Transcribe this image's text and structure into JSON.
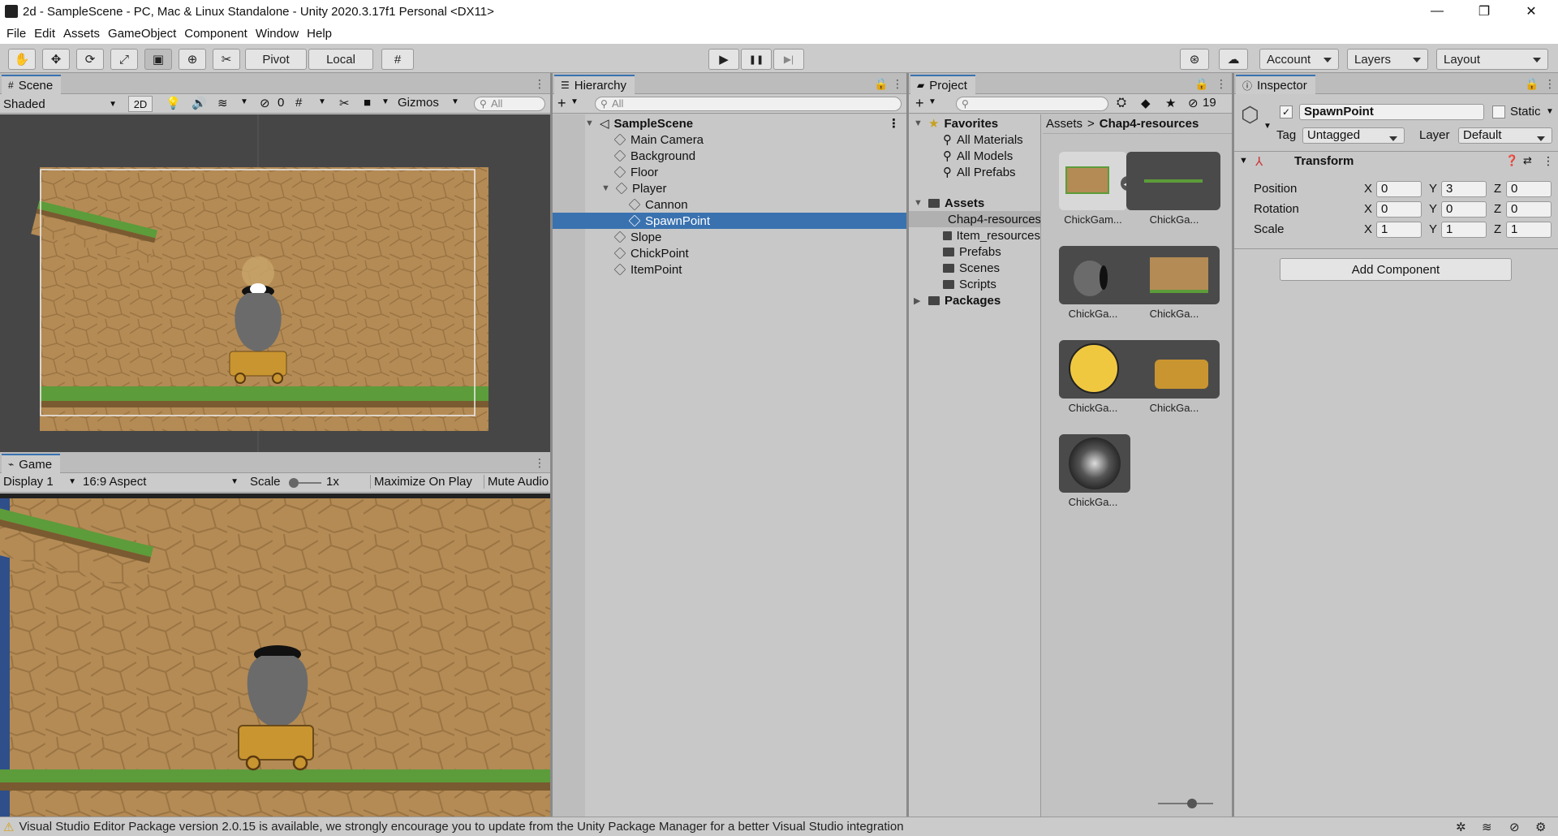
{
  "window": {
    "title": "2d - SampleScene - PC, Mac & Linux Standalone - Unity 2020.3.17f1 Personal <DX11>",
    "controls": {
      "minimize": "—",
      "maximize": "❐",
      "close": "✕"
    }
  },
  "menu": [
    "File",
    "Edit",
    "Assets",
    "GameObject",
    "Component",
    "Window",
    "Help"
  ],
  "toolbar": {
    "tools": [
      "hand-icon",
      "move-icon",
      "rotate-icon",
      "scale-icon",
      "rect-icon",
      "transform-icon",
      "custom-tool-icon"
    ],
    "pivot_label": "Pivot",
    "local_label": "Local",
    "play_icon": "▶",
    "pause_icon": "❚❚",
    "step_icon": "▶|",
    "account_label": "Account",
    "layers_label": "Layers",
    "layout_label": "Layout"
  },
  "scene": {
    "tab_label": "Scene",
    "shading_mode": "Shaded",
    "mode_2d": "2D",
    "hidden_count": "0",
    "gizmos_label": "Gizmos",
    "search_placeholder": "All"
  },
  "game": {
    "tab_label": "Game",
    "display": "Display 1",
    "aspect": "16:9 Aspect",
    "scale_label": "Scale",
    "scale_value": "1x",
    "maximize_label": "Maximize On Play",
    "mute_label": "Mute Audio"
  },
  "hierarchy": {
    "tab_label": "Hierarchy",
    "search_placeholder": "All",
    "scene_name": "SampleScene",
    "items": [
      "Main Camera",
      "Background",
      "Floor",
      "Player",
      "Cannon",
      "SpawnPoint",
      "Slope",
      "ChickPoint",
      "ItemPoint"
    ]
  },
  "project": {
    "tab_label": "Project",
    "hidden_count": "19",
    "favorites_label": "Favorites",
    "favorites": [
      "All Materials",
      "All Models",
      "All Prefabs"
    ],
    "assets_label": "Assets",
    "asset_folders": [
      "Chap4-resources",
      "Item_resources",
      "Prefabs",
      "Scenes",
      "Scripts"
    ],
    "packages_label": "Packages",
    "breadcrumb_root": "Assets",
    "breadcrumb_current": "Chap4-resources",
    "thumbnails": [
      "ChickGam...",
      "ChickGa...",
      "ChickGa...",
      "ChickGa...",
      "ChickGa...",
      "ChickGa...",
      "ChickGa..."
    ]
  },
  "inspector": {
    "tab_label": "Inspector",
    "object_name": "SpawnPoint",
    "static_label": "Static",
    "tag_label": "Tag",
    "tag_value": "Untagged",
    "layer_label": "Layer",
    "layer_value": "Default",
    "component_title": "Transform",
    "position_label": "Position",
    "rotation_label": "Rotation",
    "scale_label": "Scale",
    "position": {
      "x": "0",
      "y": "3",
      "z": "0"
    },
    "rotation": {
      "x": "0",
      "y": "0",
      "z": "0"
    },
    "scale": {
      "x": "1",
      "y": "1",
      "z": "1"
    },
    "axis": {
      "x": "X",
      "y": "Y",
      "z": "Z"
    },
    "add_component_label": "Add Component"
  },
  "status": {
    "message": "Visual Studio Editor Package version 2.0.15 is available, we strongly encourage you to update from the Unity Package Manager for a better Visual Studio integration"
  },
  "colors": {
    "selection": "#3a72b0",
    "dirt": "#b48b55",
    "grass": "#5c9c3a",
    "editor_bg": "#c8c8c8"
  }
}
